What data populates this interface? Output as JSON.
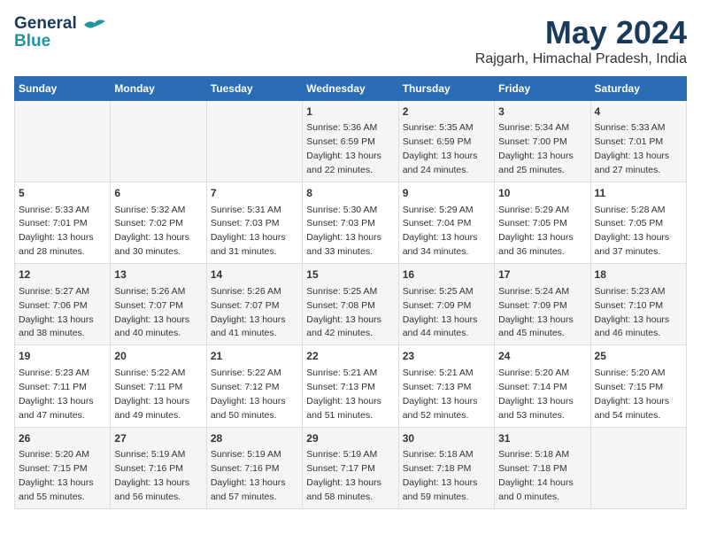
{
  "logo": {
    "line1": "General",
    "line2": "Blue"
  },
  "title": "May 2024",
  "subtitle": "Rajgarh, Himachal Pradesh, India",
  "headers": [
    "Sunday",
    "Monday",
    "Tuesday",
    "Wednesday",
    "Thursday",
    "Friday",
    "Saturday"
  ],
  "weeks": [
    [
      {
        "day": "",
        "info": ""
      },
      {
        "day": "",
        "info": ""
      },
      {
        "day": "",
        "info": ""
      },
      {
        "day": "1",
        "info": "Sunrise: 5:36 AM\nSunset: 6:59 PM\nDaylight: 13 hours\nand 22 minutes."
      },
      {
        "day": "2",
        "info": "Sunrise: 5:35 AM\nSunset: 6:59 PM\nDaylight: 13 hours\nand 24 minutes."
      },
      {
        "day": "3",
        "info": "Sunrise: 5:34 AM\nSunset: 7:00 PM\nDaylight: 13 hours\nand 25 minutes."
      },
      {
        "day": "4",
        "info": "Sunrise: 5:33 AM\nSunset: 7:01 PM\nDaylight: 13 hours\nand 27 minutes."
      }
    ],
    [
      {
        "day": "5",
        "info": "Sunrise: 5:33 AM\nSunset: 7:01 PM\nDaylight: 13 hours\nand 28 minutes."
      },
      {
        "day": "6",
        "info": "Sunrise: 5:32 AM\nSunset: 7:02 PM\nDaylight: 13 hours\nand 30 minutes."
      },
      {
        "day": "7",
        "info": "Sunrise: 5:31 AM\nSunset: 7:03 PM\nDaylight: 13 hours\nand 31 minutes."
      },
      {
        "day": "8",
        "info": "Sunrise: 5:30 AM\nSunset: 7:03 PM\nDaylight: 13 hours\nand 33 minutes."
      },
      {
        "day": "9",
        "info": "Sunrise: 5:29 AM\nSunset: 7:04 PM\nDaylight: 13 hours\nand 34 minutes."
      },
      {
        "day": "10",
        "info": "Sunrise: 5:29 AM\nSunset: 7:05 PM\nDaylight: 13 hours\nand 36 minutes."
      },
      {
        "day": "11",
        "info": "Sunrise: 5:28 AM\nSunset: 7:05 PM\nDaylight: 13 hours\nand 37 minutes."
      }
    ],
    [
      {
        "day": "12",
        "info": "Sunrise: 5:27 AM\nSunset: 7:06 PM\nDaylight: 13 hours\nand 38 minutes."
      },
      {
        "day": "13",
        "info": "Sunrise: 5:26 AM\nSunset: 7:07 PM\nDaylight: 13 hours\nand 40 minutes."
      },
      {
        "day": "14",
        "info": "Sunrise: 5:26 AM\nSunset: 7:07 PM\nDaylight: 13 hours\nand 41 minutes."
      },
      {
        "day": "15",
        "info": "Sunrise: 5:25 AM\nSunset: 7:08 PM\nDaylight: 13 hours\nand 42 minutes."
      },
      {
        "day": "16",
        "info": "Sunrise: 5:25 AM\nSunset: 7:09 PM\nDaylight: 13 hours\nand 44 minutes."
      },
      {
        "day": "17",
        "info": "Sunrise: 5:24 AM\nSunset: 7:09 PM\nDaylight: 13 hours\nand 45 minutes."
      },
      {
        "day": "18",
        "info": "Sunrise: 5:23 AM\nSunset: 7:10 PM\nDaylight: 13 hours\nand 46 minutes."
      }
    ],
    [
      {
        "day": "19",
        "info": "Sunrise: 5:23 AM\nSunset: 7:11 PM\nDaylight: 13 hours\nand 47 minutes."
      },
      {
        "day": "20",
        "info": "Sunrise: 5:22 AM\nSunset: 7:11 PM\nDaylight: 13 hours\nand 49 minutes."
      },
      {
        "day": "21",
        "info": "Sunrise: 5:22 AM\nSunset: 7:12 PM\nDaylight: 13 hours\nand 50 minutes."
      },
      {
        "day": "22",
        "info": "Sunrise: 5:21 AM\nSunset: 7:13 PM\nDaylight: 13 hours\nand 51 minutes."
      },
      {
        "day": "23",
        "info": "Sunrise: 5:21 AM\nSunset: 7:13 PM\nDaylight: 13 hours\nand 52 minutes."
      },
      {
        "day": "24",
        "info": "Sunrise: 5:20 AM\nSunset: 7:14 PM\nDaylight: 13 hours\nand 53 minutes."
      },
      {
        "day": "25",
        "info": "Sunrise: 5:20 AM\nSunset: 7:15 PM\nDaylight: 13 hours\nand 54 minutes."
      }
    ],
    [
      {
        "day": "26",
        "info": "Sunrise: 5:20 AM\nSunset: 7:15 PM\nDaylight: 13 hours\nand 55 minutes."
      },
      {
        "day": "27",
        "info": "Sunrise: 5:19 AM\nSunset: 7:16 PM\nDaylight: 13 hours\nand 56 minutes."
      },
      {
        "day": "28",
        "info": "Sunrise: 5:19 AM\nSunset: 7:16 PM\nDaylight: 13 hours\nand 57 minutes."
      },
      {
        "day": "29",
        "info": "Sunrise: 5:19 AM\nSunset: 7:17 PM\nDaylight: 13 hours\nand 58 minutes."
      },
      {
        "day": "30",
        "info": "Sunrise: 5:18 AM\nSunset: 7:18 PM\nDaylight: 13 hours\nand 59 minutes."
      },
      {
        "day": "31",
        "info": "Sunrise: 5:18 AM\nSunset: 7:18 PM\nDaylight: 14 hours\nand 0 minutes."
      },
      {
        "day": "",
        "info": ""
      }
    ]
  ]
}
